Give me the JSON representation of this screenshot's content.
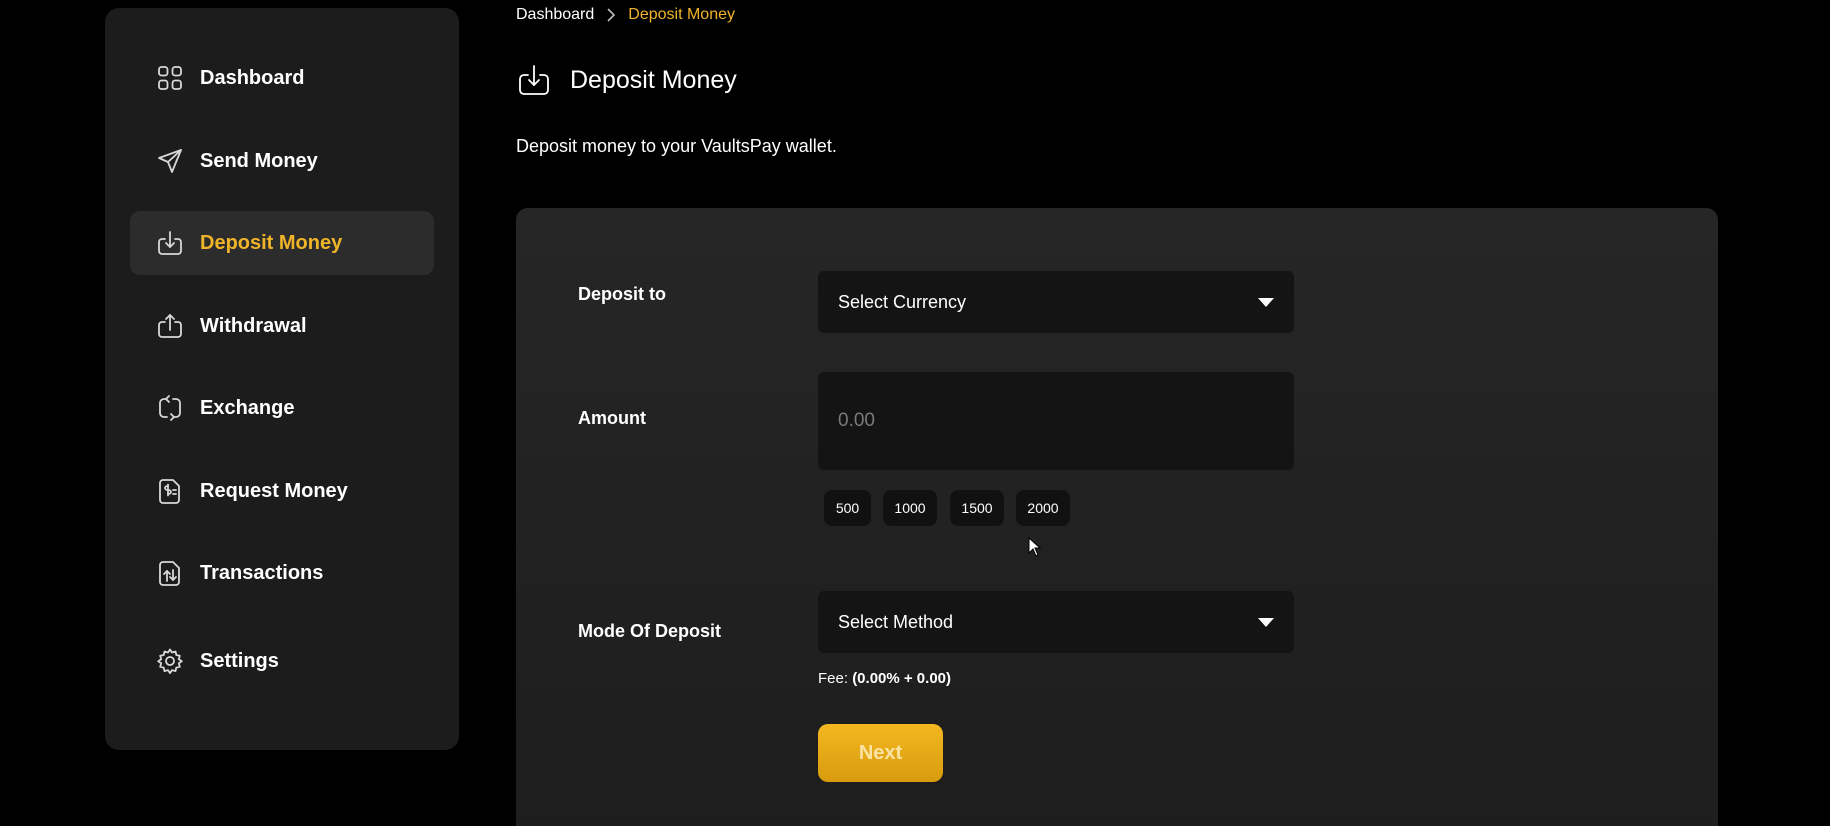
{
  "sidebar": {
    "items": [
      {
        "label": "Dashboard",
        "icon": "dashboard-grid-icon",
        "active": false
      },
      {
        "label": "Send Money",
        "icon": "paper-plane-icon",
        "active": false
      },
      {
        "label": "Deposit Money",
        "icon": "download-icon",
        "active": true
      },
      {
        "label": "Withdrawal",
        "icon": "upload-icon",
        "active": false
      },
      {
        "label": "Exchange",
        "icon": "exchange-arrows-icon",
        "active": false
      },
      {
        "label": "Request Money",
        "icon": "request-document-icon",
        "active": false
      },
      {
        "label": "Transactions",
        "icon": "transactions-icon",
        "active": false
      },
      {
        "label": "Settings",
        "icon": "gear-icon",
        "active": false
      }
    ]
  },
  "breadcrumb": {
    "items": [
      "Dashboard",
      "Deposit Money"
    ]
  },
  "header": {
    "title": "Deposit Money",
    "subtitle": "Deposit money to your VaultsPay wallet."
  },
  "form": {
    "deposit_to": {
      "label": "Deposit to",
      "value": "Select Currency"
    },
    "amount": {
      "label": "Amount",
      "placeholder": "0.00",
      "quick_amounts": [
        "500",
        "1000",
        "1500",
        "2000"
      ]
    },
    "mode_of_deposit": {
      "label": "Mode Of Deposit",
      "value": "Select Method"
    },
    "fee": {
      "label": "Fee:",
      "value": "(0.00% + 0.00)"
    },
    "next_label": "Next"
  },
  "colors": {
    "background": "#000000",
    "sidebar": "#1c1c1c",
    "card": "#262626",
    "accent": "#f0b429",
    "input_bg": "#141414"
  }
}
